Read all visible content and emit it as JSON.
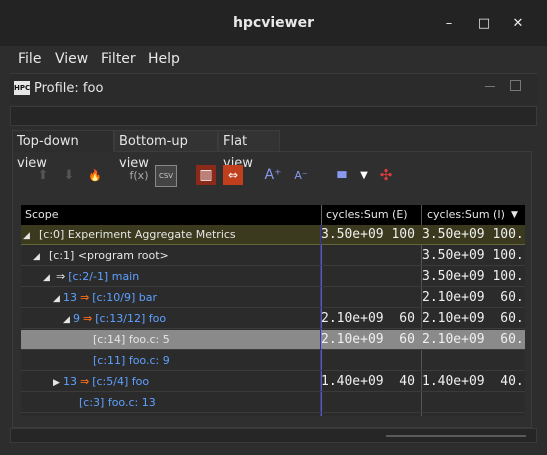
{
  "window": {
    "title": "hpcviewer",
    "minimize_glyph": "–",
    "maximize_glyph": "□",
    "close_glyph": "✕"
  },
  "menu": [
    "File",
    "View",
    "Filter",
    "Help"
  ],
  "profile": {
    "icon_text": "HPC",
    "title": "Profile: foo"
  },
  "tabs": [
    {
      "label": "Top-down view",
      "active": true
    },
    {
      "label": "Bottom-up view",
      "active": false
    },
    {
      "label": "Flat view",
      "active": false
    }
  ],
  "toolbar": {
    "icons": [
      "zoom-in-icon",
      "zoom-out-icon",
      "hot-path-icon",
      "derived-metric-icon",
      "csv-export-icon",
      "column-select-icon",
      "resize-columns-icon",
      "font-increase-icon",
      "font-decrease-icon",
      "graph-icon",
      "dropdown-icon",
      "thread-view-icon"
    ],
    "glyphs": {
      "zoom_in": "⬆",
      "zoom_out": "⬇",
      "hot_path": "🔥",
      "derived": "f(x)",
      "csv": "CSV",
      "column": "▥",
      "resize": "⇔",
      "font_up": "A⁺",
      "font_down": "A⁻",
      "graph": "▮▮▮",
      "dropdown": "▼",
      "thread": "✣"
    }
  },
  "table": {
    "headers": {
      "scope": "Scope",
      "exclusive": "cycles:Sum (E)",
      "inclusive": "cycles:Sum (I)",
      "sort_glyph": "▼"
    },
    "rows": [
      {
        "tri": "◢",
        "count": "",
        "call": "",
        "label": "[c:0] Experiment Aggregate Metrics",
        "link": false,
        "e": "3.50e+09 100",
        "i": "3.50e+09 100.",
        "root": true,
        "sel": false
      },
      {
        "tri": "◢",
        "count": "",
        "call": "",
        "label": "[c:1] <program root>",
        "link": false,
        "e": "",
        "i": "3.50e+09 100.",
        "root": false,
        "sel": false
      },
      {
        "tri": "◢",
        "count": "",
        "call": "⇒",
        "label": "[c:2/-1] main",
        "link": true,
        "e": "",
        "i": "3.50e+09 100.",
        "root": false,
        "sel": false
      },
      {
        "tri": "◢",
        "count": "13",
        "call": "⇒",
        "label": "[c:10/9] bar",
        "link": true,
        "e": "",
        "i": "2.10e+09  60.",
        "root": false,
        "sel": false
      },
      {
        "tri": "◢",
        "count": "9",
        "call": "⇒",
        "label": "[c:13/12] foo",
        "link": true,
        "e": "2.10e+09  60",
        "i": "2.10e+09  60.",
        "root": false,
        "sel": false
      },
      {
        "tri": "",
        "count": "",
        "call": "",
        "label": "[c:14] foo.c: 5",
        "link": false,
        "e": "2.10e+09  60",
        "i": "2.10e+09  60.",
        "root": false,
        "sel": true
      },
      {
        "tri": "",
        "count": "",
        "call": "",
        "label": "[c:11] foo.c: 9",
        "link": true,
        "e": "",
        "i": "",
        "root": false,
        "sel": false
      },
      {
        "tri": "▶",
        "count": "13",
        "call": "⇒",
        "label": "[c:5/4] foo",
        "link": true,
        "e": "1.40e+09  40",
        "i": "1.40e+09  40.",
        "root": false,
        "sel": false
      },
      {
        "tri": "",
        "count": "",
        "call": "",
        "label": "[c:3] foo.c: 13",
        "link": true,
        "e": "",
        "i": "",
        "root": false,
        "sel": false
      }
    ]
  },
  "colors": {
    "link": "#5ea1ff",
    "call_arrow": "#f26b1d",
    "metric_separator": "#3333cc",
    "root_row": "#3b3a1e",
    "selected_row": "#8a8a8a"
  }
}
